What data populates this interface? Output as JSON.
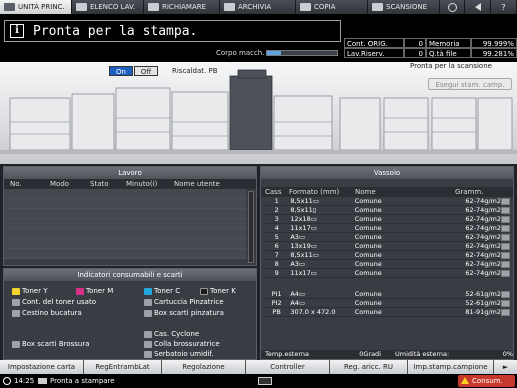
{
  "tabs": [
    {
      "label": "UNITÀ PRINC.",
      "icon": "printer-unit-icon",
      "active": true
    },
    {
      "label": "ELENCO LAV.",
      "icon": "job-list-icon",
      "active": false
    },
    {
      "label": "RICHIAMARE",
      "icon": "recall-icon",
      "active": false
    },
    {
      "label": "ARCHIVIA",
      "icon": "archive-icon",
      "active": false
    },
    {
      "label": "COPIA",
      "icon": "copy-icon",
      "active": false
    },
    {
      "label": "SCANSIONE",
      "icon": "scan-icon",
      "active": false
    }
  ],
  "tab_icons": [
    "globe-icon",
    "speaker-icon",
    "help-icon"
  ],
  "tab_help": "?",
  "status": {
    "message": "Pronta per la stampa.",
    "info_symbol": "i",
    "corpo_label": "Corpo macch.",
    "corpo_level": 0.2
  },
  "counters": {
    "row1": {
      "label1": "Cont. ORIG.",
      "value1": "0",
      "label2": "Memoria",
      "value2": "99.999%"
    },
    "row2": {
      "label1": "Lav.Riserv.",
      "value1": "0",
      "label2": "Q.tà file",
      "value2": "99.281%"
    }
  },
  "machine": {
    "on_label": "On",
    "off_label": "Off",
    "riscaldat": "Riscaldat. PB",
    "scan_status": "Pronta per la scansione",
    "esegui": "Esegui stam. camp."
  },
  "lavoro": {
    "title": "Lavoro",
    "headers": [
      "No.",
      "Modo",
      "Stato",
      "Minuto(i)",
      "Nome utente"
    ]
  },
  "consumabili": {
    "title": "Indicatori consumabili e scarti",
    "items": [
      "Toner Y",
      "Toner M",
      "Toner C",
      "Toner K",
      "Cont. del toner usato",
      "Cartuccia Pinzatrice",
      "Cestino bucatura",
      "Box scarti pinzatura",
      "Box scarti Brossura",
      "Cas. Cyclone",
      "Colla brossuratrice",
      "Serbatoio umidif."
    ]
  },
  "vassoio": {
    "title": "Vassoio",
    "headers": [
      "Cass",
      "Formato (mm)",
      "Nome",
      "Gramm."
    ],
    "rows": [
      {
        "cass": "1",
        "formato": "8,5x11▭",
        "nome": "Comune",
        "gramm": "62-74g/m2"
      },
      {
        "cass": "2",
        "formato": "8,5x11▯",
        "nome": "Comune",
        "gramm": "62-74g/m2"
      },
      {
        "cass": "3",
        "formato": "12x18▭",
        "nome": "Comune",
        "gramm": "62-74g/m2"
      },
      {
        "cass": "4",
        "formato": "11x17▭",
        "nome": "Comune",
        "gramm": "62-74g/m2"
      },
      {
        "cass": "5",
        "formato": "A3▭",
        "nome": "Comune",
        "gramm": "62-74g/m2"
      },
      {
        "cass": "6",
        "formato": "13x19▭",
        "nome": "Comune",
        "gramm": "62-74g/m2"
      },
      {
        "cass": "7",
        "formato": "8,5x11▭",
        "nome": "Comune",
        "gramm": "62-74g/m2"
      },
      {
        "cass": "8",
        "formato": "A3▭",
        "nome": "Comune",
        "gramm": "62-74g/m2"
      },
      {
        "cass": "9",
        "formato": "11x17▭",
        "nome": "Comune",
        "gramm": "62-74g/m2"
      },
      {
        "cass": "PI1",
        "formato": "A4▭",
        "nome": "Comune",
        "gramm": "52-61g/m2"
      },
      {
        "cass": "PI2",
        "formato": "A4▭",
        "nome": "Comune",
        "gramm": "52-61g/m2"
      },
      {
        "cass": "PB",
        "formato": "307.0 x 472.0",
        "nome": "Comune",
        "gramm": "81-91g/m2"
      }
    ],
    "footer": {
      "temp_label": "Temp.esterna",
      "temp_value": "0Gradi",
      "umid_label": "Umidità esterna:",
      "umid_value": "0%"
    }
  },
  "buttons": [
    "Impostazione carta",
    "RegEntrambLat",
    "Regolazione",
    "Controller",
    "Reg. aricc. RU",
    "Imp.stamp.campione"
  ],
  "next_arrow": "►",
  "footer": {
    "time": "14:25",
    "status": "Pronta a stampare",
    "consum": "Consum."
  },
  "colors": {
    "accent": "#1f5fbf",
    "alert": "#c63a2e",
    "toner_y": "#f2d32b",
    "toner_m": "#d4328a",
    "toner_c": "#25a7e0",
    "toner_k": "#1a1a1a"
  }
}
